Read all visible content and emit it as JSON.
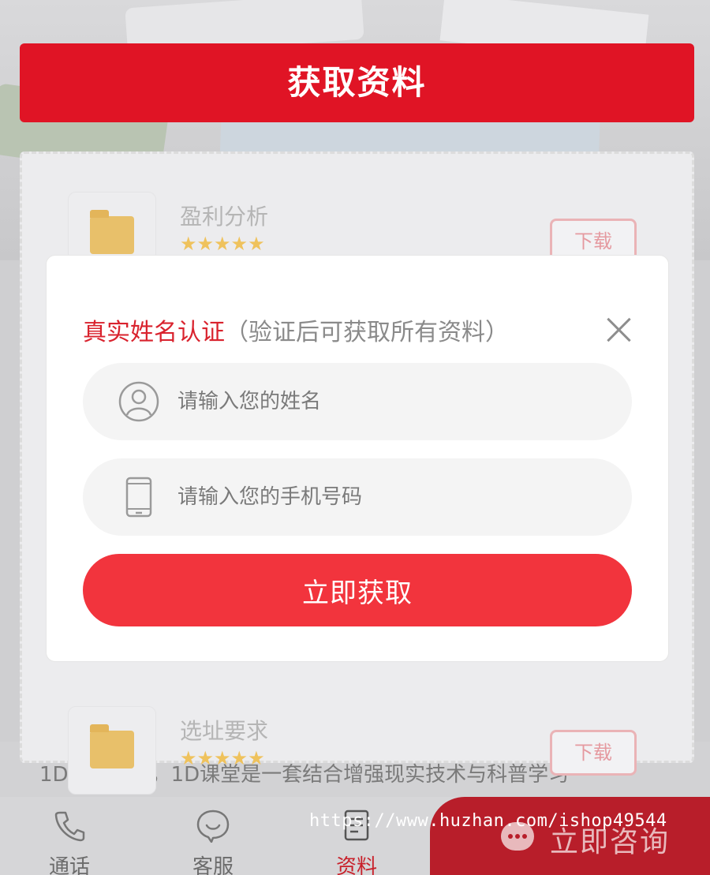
{
  "panel": {
    "header_title": "获取资料",
    "items": [
      {
        "title": "盈利分析",
        "rating": "★★★★★",
        "download_label": "下载"
      },
      {
        "title": "选址要求",
        "rating": "★★★★★",
        "download_label": "下载"
      }
    ]
  },
  "modal": {
    "title_main": "真实姓名认证",
    "title_hint": "（验证后可获取所有资料）",
    "name_placeholder": "请输入您的姓名",
    "phone_placeholder": "请输入您的手机号码",
    "submit_label": "立即获取"
  },
  "background": {
    "article_text": "1D蓝冒现类，1D课堂是一套结合增强现实技术与科普学习"
  },
  "tabbar": {
    "tabs": [
      {
        "label": "通话",
        "icon": "phone-icon"
      },
      {
        "label": "客服",
        "icon": "chat-face-icon"
      },
      {
        "label": "资料",
        "icon": "document-icon",
        "active": true
      }
    ],
    "consult_label": "立即咨询"
  },
  "watermark": "https://www.huzhan.com/ishop49544",
  "colors": {
    "brand_red": "#e01425",
    "button_red": "#f2343d",
    "title_red": "#d9232e"
  }
}
